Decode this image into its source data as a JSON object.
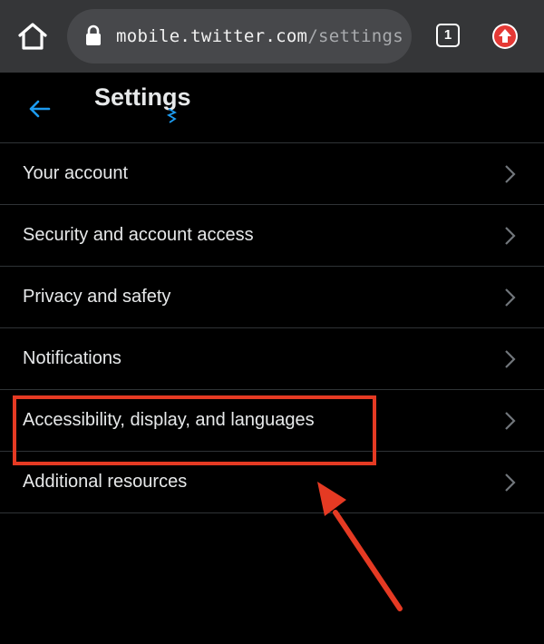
{
  "browser": {
    "url_host": "mobile.twitter.com",
    "url_path": "/settings",
    "tab_count": "1"
  },
  "header": {
    "title": "Settings"
  },
  "settings": {
    "items": [
      {
        "label": "Your account"
      },
      {
        "label": "Security and account access"
      },
      {
        "label": "Privacy and safety"
      },
      {
        "label": "Notifications"
      },
      {
        "label": "Accessibility, display, and languages"
      },
      {
        "label": "Additional resources"
      }
    ]
  },
  "colors": {
    "accent": "#1d9bf0",
    "annotation": "#e53a23",
    "background": "#000000",
    "browser_chrome": "#353638"
  },
  "icons": {
    "home": "home-icon",
    "lock": "lock-icon",
    "back": "back-arrow-icon",
    "chevron": "chevron-right-icon",
    "upgrade": "upgrade-icon"
  }
}
